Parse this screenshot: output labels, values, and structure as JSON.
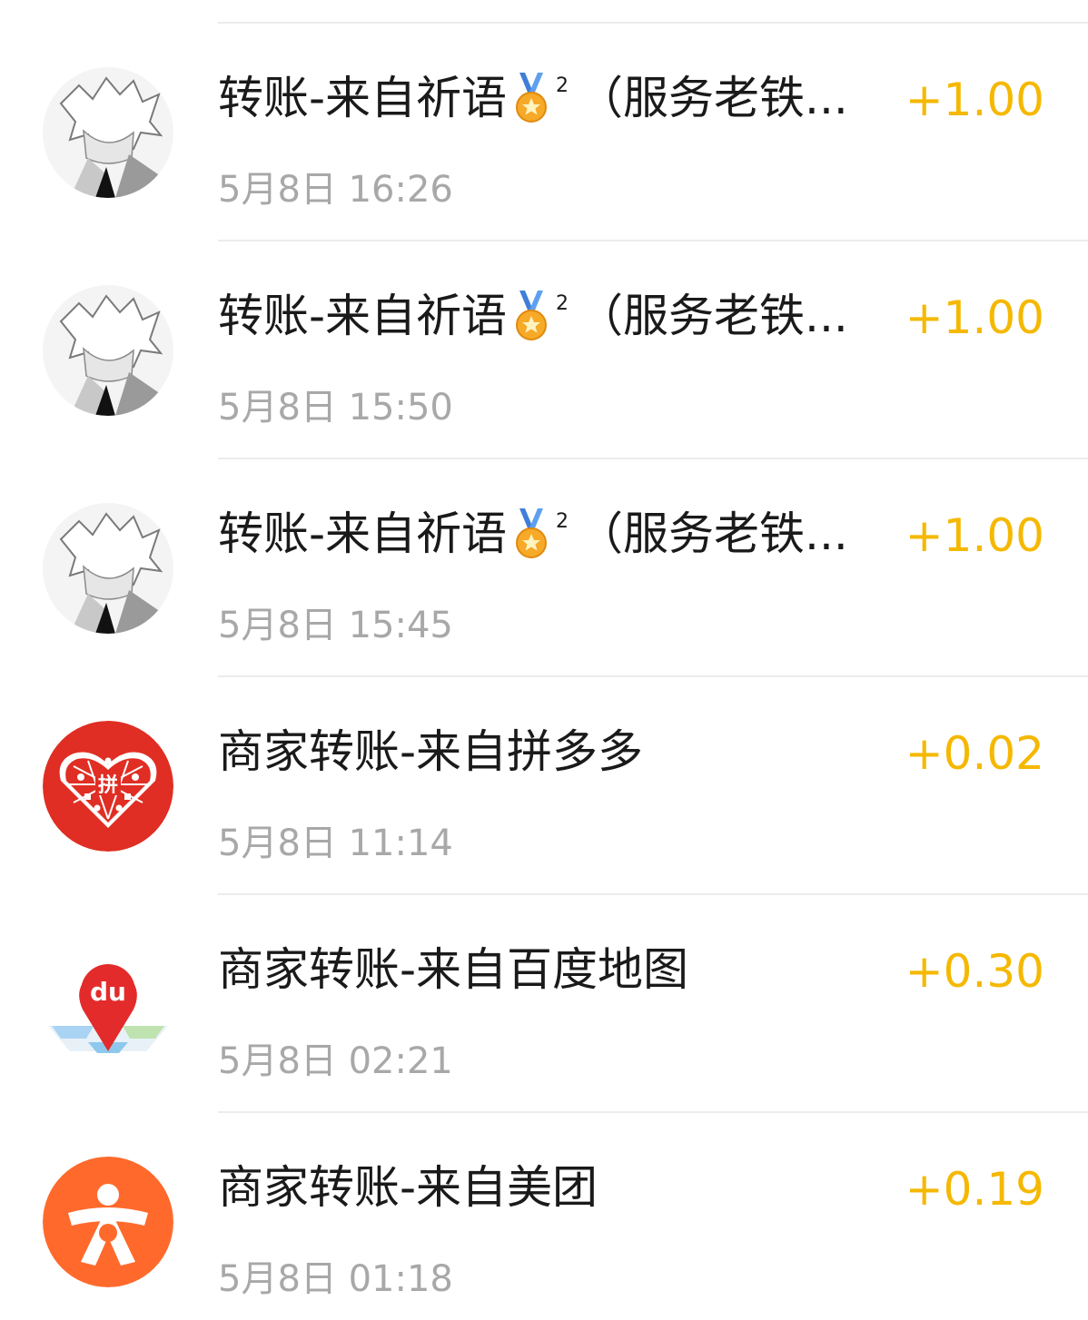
{
  "colors": {
    "amount": "#f5b800",
    "title": "#1a1a1a",
    "time": "#a8a8a8",
    "divider": "#ececec",
    "pinduoduo_red": "#e02e24",
    "meituan_orange": "#ff6a2c",
    "baidu_red": "#e32b2b"
  },
  "transactions": [
    {
      "avatar_icon": "anime-avatar-icon",
      "title_before": "转账-来自祈语",
      "badge_icon": "medal-icon",
      "badge_sup": "2",
      "title_after": "（服务老铁...",
      "time": "5月8日 16:26",
      "amount": "+1.00"
    },
    {
      "avatar_icon": "anime-avatar-icon",
      "title_before": "转账-来自祈语",
      "badge_icon": "medal-icon",
      "badge_sup": "2",
      "title_after": "（服务老铁...",
      "time": "5月8日 15:50",
      "amount": "+1.00"
    },
    {
      "avatar_icon": "anime-avatar-icon",
      "title_before": "转账-来自祈语",
      "badge_icon": "medal-icon",
      "badge_sup": "2",
      "title_after": "（服务老铁...",
      "time": "5月8日 15:45",
      "amount": "+1.00"
    },
    {
      "avatar_icon": "pinduoduo-logo-icon",
      "logo_text": "拼",
      "title": "商家转账-来自拼多多",
      "time": "5月8日 11:14",
      "amount": "+0.02"
    },
    {
      "avatar_icon": "baidu-map-logo-icon",
      "logo_text": "du",
      "title": "商家转账-来自百度地图",
      "time": "5月8日 02:21",
      "amount": "+0.30"
    },
    {
      "avatar_icon": "meituan-logo-icon",
      "title": "商家转账-来自美团",
      "time": "5月8日 01:18",
      "amount": "+0.19"
    }
  ]
}
